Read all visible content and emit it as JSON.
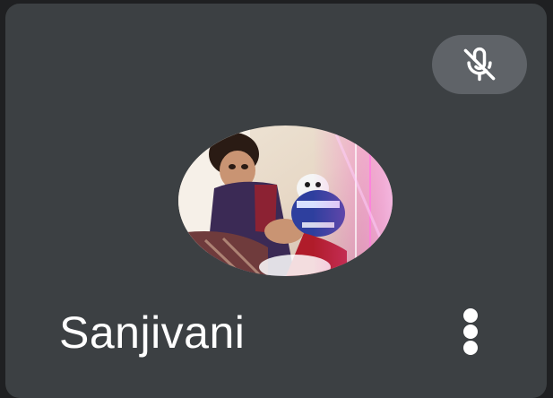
{
  "participant": {
    "name": "Sanjivani",
    "mic_status_icon": "mic-off-icon",
    "menu_icon": "more-vert-icon",
    "avatar": "participant-avatar-photo"
  },
  "colors": {
    "tile_background": "#3c4043",
    "badge_background": "#5f6368",
    "text": "#ffffff"
  }
}
